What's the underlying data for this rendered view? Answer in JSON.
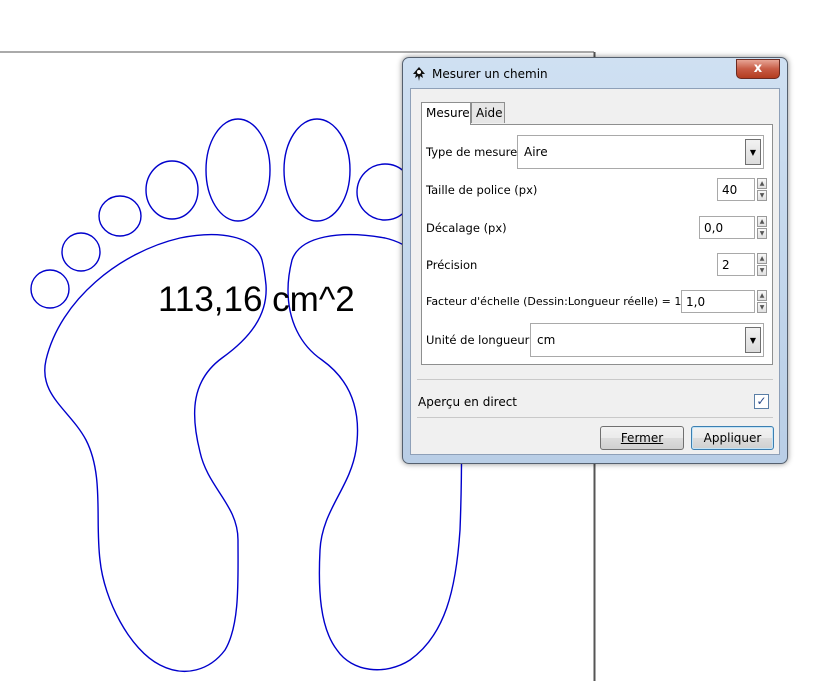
{
  "canvas": {
    "measurement_label": "113,16 cm^2",
    "path_color": "#0000cc"
  },
  "dialog": {
    "title": "Mesurer un chemin",
    "app_icon": "inkscape-icon",
    "close_glyph": "x",
    "tabs": [
      {
        "label": "Mesurer",
        "active": true
      },
      {
        "label": "Aide",
        "active": false
      }
    ],
    "fields": {
      "measure_type": {
        "label": "Type de mesure :",
        "value": "Aire"
      },
      "font_size": {
        "label": "Taille de police (px)",
        "value": "40"
      },
      "offset": {
        "label": "Décalage (px)",
        "value": "0,0"
      },
      "precision": {
        "label": "Précision",
        "value": "2"
      },
      "scale": {
        "label": "Facteur d'échelle (Dessin:Longueur réelle) = 1",
        "value": "1,0"
      },
      "length_unit": {
        "label": "Unité de longueur :",
        "value": "cm"
      }
    },
    "live_preview": {
      "label": "Aperçu en direct",
      "checked": true
    },
    "buttons": {
      "close_label": "Fermer",
      "apply_label": "Appliquer"
    }
  }
}
